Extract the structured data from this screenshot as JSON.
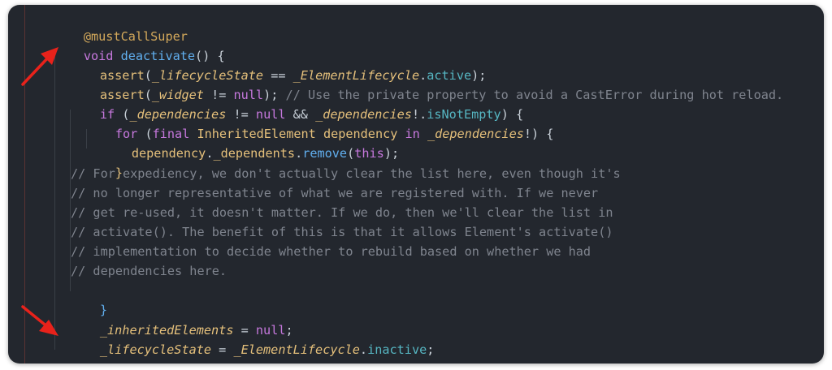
{
  "editor": {
    "line1": {
      "annotation": "@mustCallSuper"
    },
    "line2": {
      "kw": "void",
      "fn": "deactivate",
      "rest": "() {"
    },
    "line3": {
      "call": "assert",
      "open": "(",
      "var": "_lifecycleState",
      "op": " == ",
      "type": "_ElementLifecycle",
      "dot": ".",
      "prop": "active",
      "close": ");"
    },
    "line4": {
      "call": "assert",
      "open": "(",
      "var": "_widget",
      "op": " != ",
      "kw": "null",
      "close": ");",
      "comment": " // Use the private property to avoid a CastError during hot reload."
    },
    "line5": {
      "kw": "if",
      "open": " (",
      "var1": "_dependencies",
      "op1": " != ",
      "kw2": "null",
      "op2": " && ",
      "var2": "_dependencies",
      "mid": "!.",
      "prop": "isNotEmpty",
      "close": ") {"
    },
    "line6": {
      "kw": "for",
      "open": " (",
      "kw2": "final",
      "sp": " ",
      "type": "InheritedElement",
      "mid": " dependency ",
      "kw3": "in",
      "sp2": " ",
      "var": "_dependencies",
      "close": "!) {"
    },
    "line7": {
      "var1": "dependency",
      "dot1": ".",
      "var2": "_dependents",
      "dot2": ".",
      "fn": "remove",
      "open": "(",
      "kw": "this",
      "close": ");"
    },
    "line8": {
      "text": "}"
    },
    "comment_lines": [
      "// For expediency, we don't actually clear the list here, even though it's",
      "// no longer representative of what we are registered with. If we never",
      "// get re-used, it doesn't matter. If we do, then we'll clear the list in",
      "// activate(). The benefit of this is that it allows Element's activate()",
      "// implementation to decide whether to rebuild based on whether we had",
      "// dependencies here."
    ],
    "line15": {
      "text": "}"
    },
    "line16": {
      "var": "_inheritedElements",
      "op": " = ",
      "kw": "null",
      "close": ";"
    },
    "line17": {
      "var": "_lifecycleState",
      "op": " = ",
      "type": "_ElementLifecycle",
      "dot": ".",
      "prop": "inactive",
      "close": ";"
    },
    "line18": {
      "text": "}"
    }
  },
  "colors": {
    "background": "#23272e",
    "keyword": "#c678dd",
    "function": "#61afef",
    "variable": "#e5c07b",
    "property": "#56b6c2",
    "comment": "#7f848e",
    "annotation_arrow": "#e8221b"
  }
}
